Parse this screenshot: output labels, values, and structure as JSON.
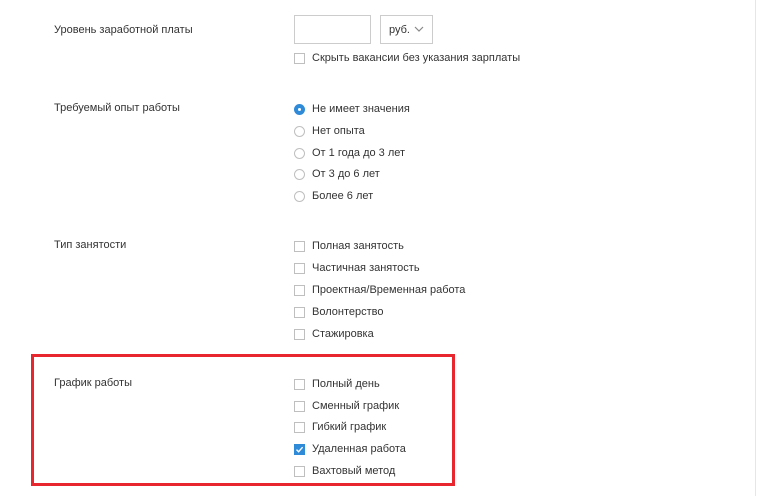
{
  "salary": {
    "label": "Уровень заработной платы",
    "input_value": "",
    "currency": "руб.",
    "hide_without_salary": {
      "label": "Скрыть вакансии без указания зарплаты",
      "checked": false
    }
  },
  "experience": {
    "label": "Требуемый опыт работы",
    "options": [
      {
        "label": "Не имеет значения",
        "checked": true
      },
      {
        "label": "Нет опыта",
        "checked": false
      },
      {
        "label": "От 1 года до 3 лет",
        "checked": false
      },
      {
        "label": "От 3 до 6 лет",
        "checked": false
      },
      {
        "label": "Более 6 лет",
        "checked": false
      }
    ]
  },
  "employment": {
    "label": "Тип занятости",
    "options": [
      {
        "label": "Полная занятость",
        "checked": false
      },
      {
        "label": "Частичная занятость",
        "checked": false
      },
      {
        "label": "Проектная/Временная работа",
        "checked": false
      },
      {
        "label": "Волонтерство",
        "checked": false
      },
      {
        "label": "Стажировка",
        "checked": false
      }
    ]
  },
  "schedule": {
    "label": "График работы",
    "options": [
      {
        "label": "Полный день",
        "checked": false
      },
      {
        "label": "Сменный график",
        "checked": false
      },
      {
        "label": "Гибкий график",
        "checked": false
      },
      {
        "label": "Удаленная работа",
        "checked": true
      },
      {
        "label": "Вахтовый метод",
        "checked": false
      }
    ]
  },
  "colors": {
    "accent": "#2f8ad8",
    "highlight": "#e8262d"
  }
}
